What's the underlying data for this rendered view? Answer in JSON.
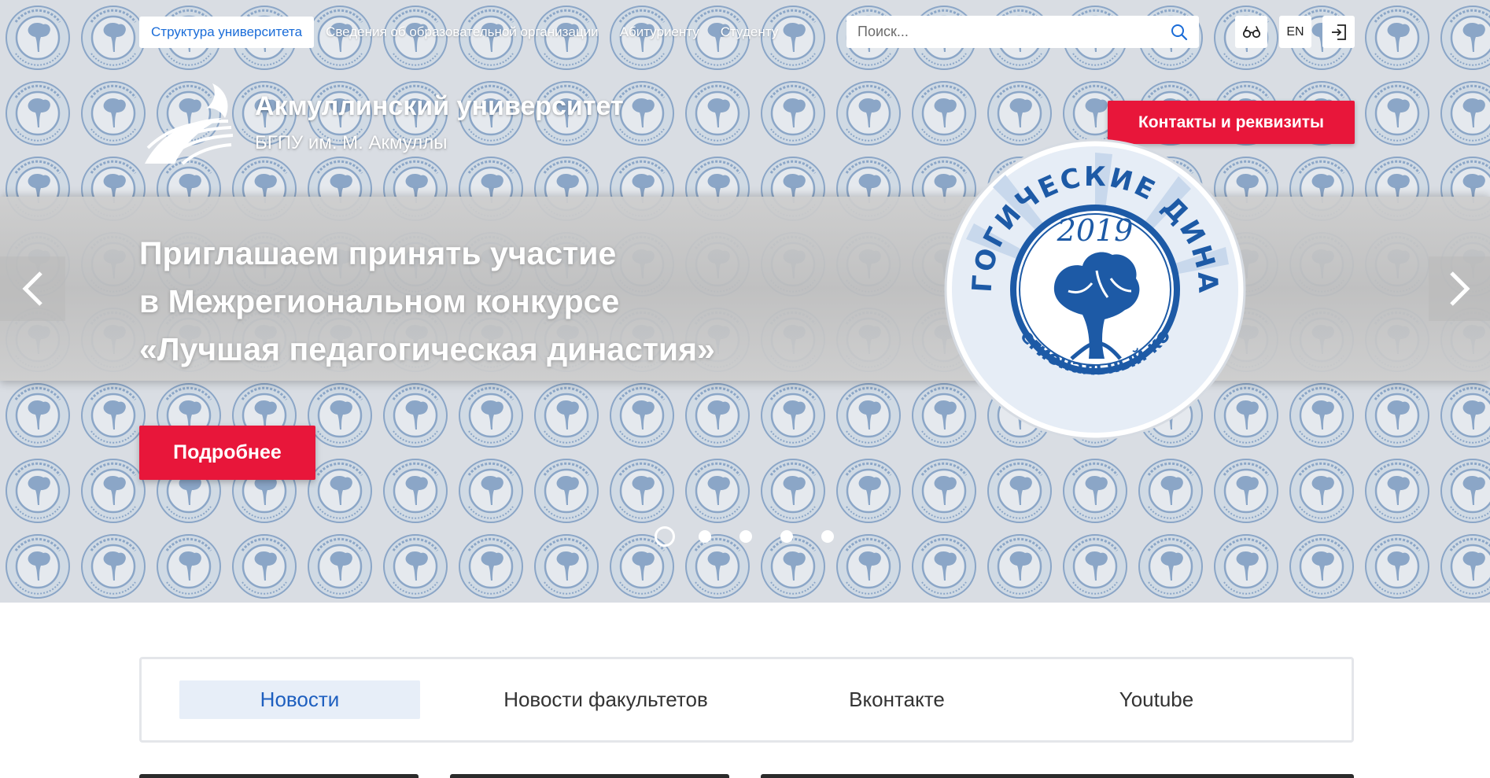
{
  "header": {
    "nav": [
      {
        "label": "Структура университета",
        "active": true
      },
      {
        "label": "Сведения об образовательной организации",
        "active": false
      },
      {
        "label": "Абитуриенту",
        "active": false
      },
      {
        "label": "Студенту",
        "active": false
      }
    ],
    "search": {
      "placeholder": "Поиск..."
    },
    "visually_impaired_icon": "glasses-icon",
    "lang_label": "EN",
    "login_icon": "login-icon"
  },
  "brand": {
    "name": "Акмуллинский университет",
    "subtitle": "БГПУ им. М. Акмуллы"
  },
  "contacts_button": "Контакты и реквизиты",
  "slide": {
    "headline_lines": [
      "Приглашаем принять участие",
      "в Межрегиональном конкурсе",
      "«Лучшая педагогическая династия»"
    ],
    "more_button": "Подробнее",
    "emblem": {
      "arc_top": "ПЕДАГОГИЧЕСКИЕ ДИНАСТИИ",
      "year": "2019",
      "arc_bottom": "Межрегиональный конкурс"
    },
    "slide_count": 5,
    "current_slide": 1
  },
  "tabs": [
    {
      "label": "Новости",
      "active": true
    },
    {
      "label": "Новости факультетов",
      "active": false
    },
    {
      "label": "Вконтакте",
      "active": false
    },
    {
      "label": "Youtube",
      "active": false
    }
  ],
  "colors": {
    "accent_red": "#e8163a",
    "link_blue": "#1a6cd8",
    "emblem_blue": "#1d5aa6"
  }
}
